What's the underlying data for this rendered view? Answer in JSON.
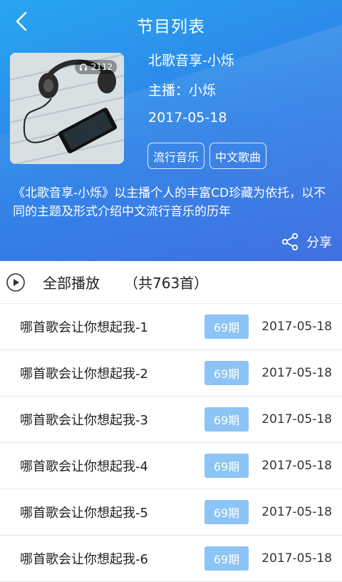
{
  "header": {
    "title": "节目列表",
    "back_icon": "chevron-left-icon"
  },
  "album": {
    "play_count": "2112",
    "name": "北歌音享-小烁",
    "host": "主播：小烁",
    "date": "2017-05-18",
    "tags": [
      "流行音乐",
      "中文歌曲"
    ],
    "description": "《北歌音享-小烁》以主播个人的丰富CD珍藏为依托，以不同的主题及形式介绍中文流行音乐的历年",
    "share_label": "分享"
  },
  "playall": {
    "label": "全部播放",
    "count": "（共763首）"
  },
  "episodes": [
    {
      "title": "哪首歌会让你想起我-1",
      "badge": "69期",
      "date": "2017-05-18"
    },
    {
      "title": "哪首歌会让你想起我-2",
      "badge": "69期",
      "date": "2017-05-18"
    },
    {
      "title": "哪首歌会让你想起我-3",
      "badge": "69期",
      "date": "2017-05-18"
    },
    {
      "title": "哪首歌会让你想起我-4",
      "badge": "69期",
      "date": "2017-05-18"
    },
    {
      "title": "哪首歌会让你想起我-5",
      "badge": "69期",
      "date": "2017-05-18"
    },
    {
      "title": "哪首歌会让你想起我-6",
      "badge": "69期",
      "date": "2017-05-18"
    }
  ],
  "colors": {
    "header_blue": "#2f80e8",
    "badge_blue": "#8cc4f5"
  }
}
